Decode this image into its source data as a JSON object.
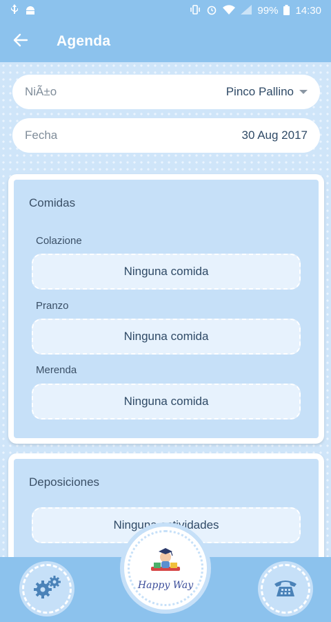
{
  "status_bar": {
    "battery_percent": "99%",
    "time": "14:30",
    "left_icons": [
      "usb-icon",
      "android-icon"
    ],
    "right_icons": [
      "vibrate-icon",
      "alarm-icon",
      "wifi-icon",
      "signal-icon",
      "battery-icon"
    ]
  },
  "app_bar": {
    "title": "Agenda",
    "back_icon": "arrow-left-icon"
  },
  "child_selector": {
    "label": "NiÃ±o",
    "value": "Pinco Pallino"
  },
  "date_row": {
    "label": "Fecha",
    "value": "30 Aug 2017"
  },
  "meals_card": {
    "title": "Comidas",
    "meals": [
      {
        "label": "Colazione",
        "value": "Ninguna comida"
      },
      {
        "label": "Pranzo",
        "value": "Ninguna comida"
      },
      {
        "label": "Merenda",
        "value": "Ninguna comida"
      }
    ]
  },
  "depositions_card": {
    "title": "Deposiciones",
    "value": "Ninguna actividades"
  },
  "bottom_bar": {
    "left_icon": "gears-icon",
    "right_icon": "telephone-icon",
    "logo_text": "Happy Way"
  },
  "colors": {
    "primary": "#8cc2ed",
    "panel": "#c6e0f8",
    "text": "#2f4a66"
  }
}
